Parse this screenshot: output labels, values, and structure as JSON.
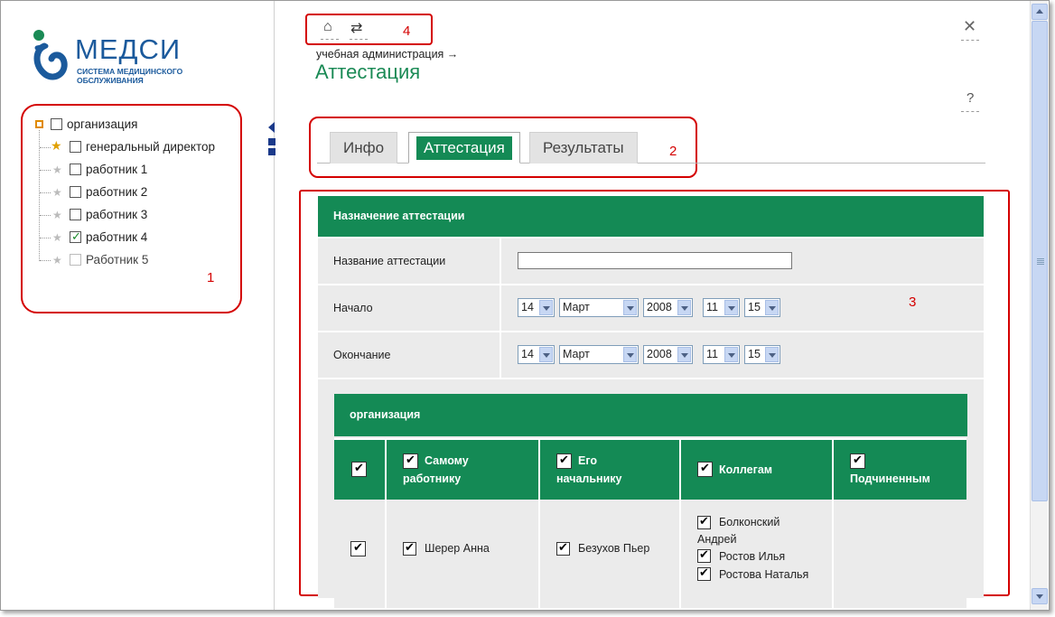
{
  "logo": {
    "word": "МЕДСИ",
    "sub1": "СИСТЕМА МЕДИЦИНСКОГО",
    "sub2": "ОБСЛУЖИВАНИЯ"
  },
  "tree": {
    "root": {
      "label": "организация",
      "checked": false
    },
    "items": [
      {
        "label": "генеральный директор",
        "checked": false
      },
      {
        "label": "работник 1",
        "checked": false
      },
      {
        "label": "работник 2",
        "checked": false
      },
      {
        "label": "работник 3",
        "checked": false
      },
      {
        "label": "работник 4",
        "checked": true
      },
      {
        "label": "Работник 5",
        "checked": false
      }
    ]
  },
  "annotations": {
    "n1": "1",
    "n2": "2",
    "n3": "3",
    "n4": "4"
  },
  "header": {
    "breadcrumb": "учебная администрация →",
    "title": "Аттестация"
  },
  "tabs": [
    {
      "label": "Инфо",
      "active": false
    },
    {
      "label": "Аттестация",
      "active": true
    },
    {
      "label": "Результаты",
      "active": false
    }
  ],
  "form": {
    "section_title": "Назначение аттестации",
    "name_label": "Название аттестации",
    "name_value": "",
    "start_label": "Начало",
    "end_label": "Окончание",
    "start": {
      "day": "14",
      "month": "Март",
      "year": "2008",
      "hour": "11",
      "minute": "15"
    },
    "end": {
      "day": "14",
      "month": "Март",
      "year": "2008",
      "hour": "11",
      "minute": "15"
    }
  },
  "org_table": {
    "title": "организация",
    "columns": [
      {
        "label": "",
        "checked": true
      },
      {
        "label_line1": "Самому",
        "label_line2": "работнику",
        "checked": true
      },
      {
        "label_line1": "Его",
        "label_line2": "начальнику",
        "checked": true
      },
      {
        "label_line1": "Коллегам",
        "label_line2": "",
        "checked": true
      },
      {
        "label_line1": "",
        "label_line2": "Подчиненным",
        "checked": true
      }
    ],
    "row": {
      "select": true,
      "self": "Шерер Анна",
      "boss": "Безухов Пьер",
      "colleagues": [
        "Болконский",
        "Андрей",
        "Ростов Илья",
        "Ростова Наталья"
      ]
    }
  },
  "colors": {
    "accent": "#148a55",
    "annotation": "#d40000"
  }
}
